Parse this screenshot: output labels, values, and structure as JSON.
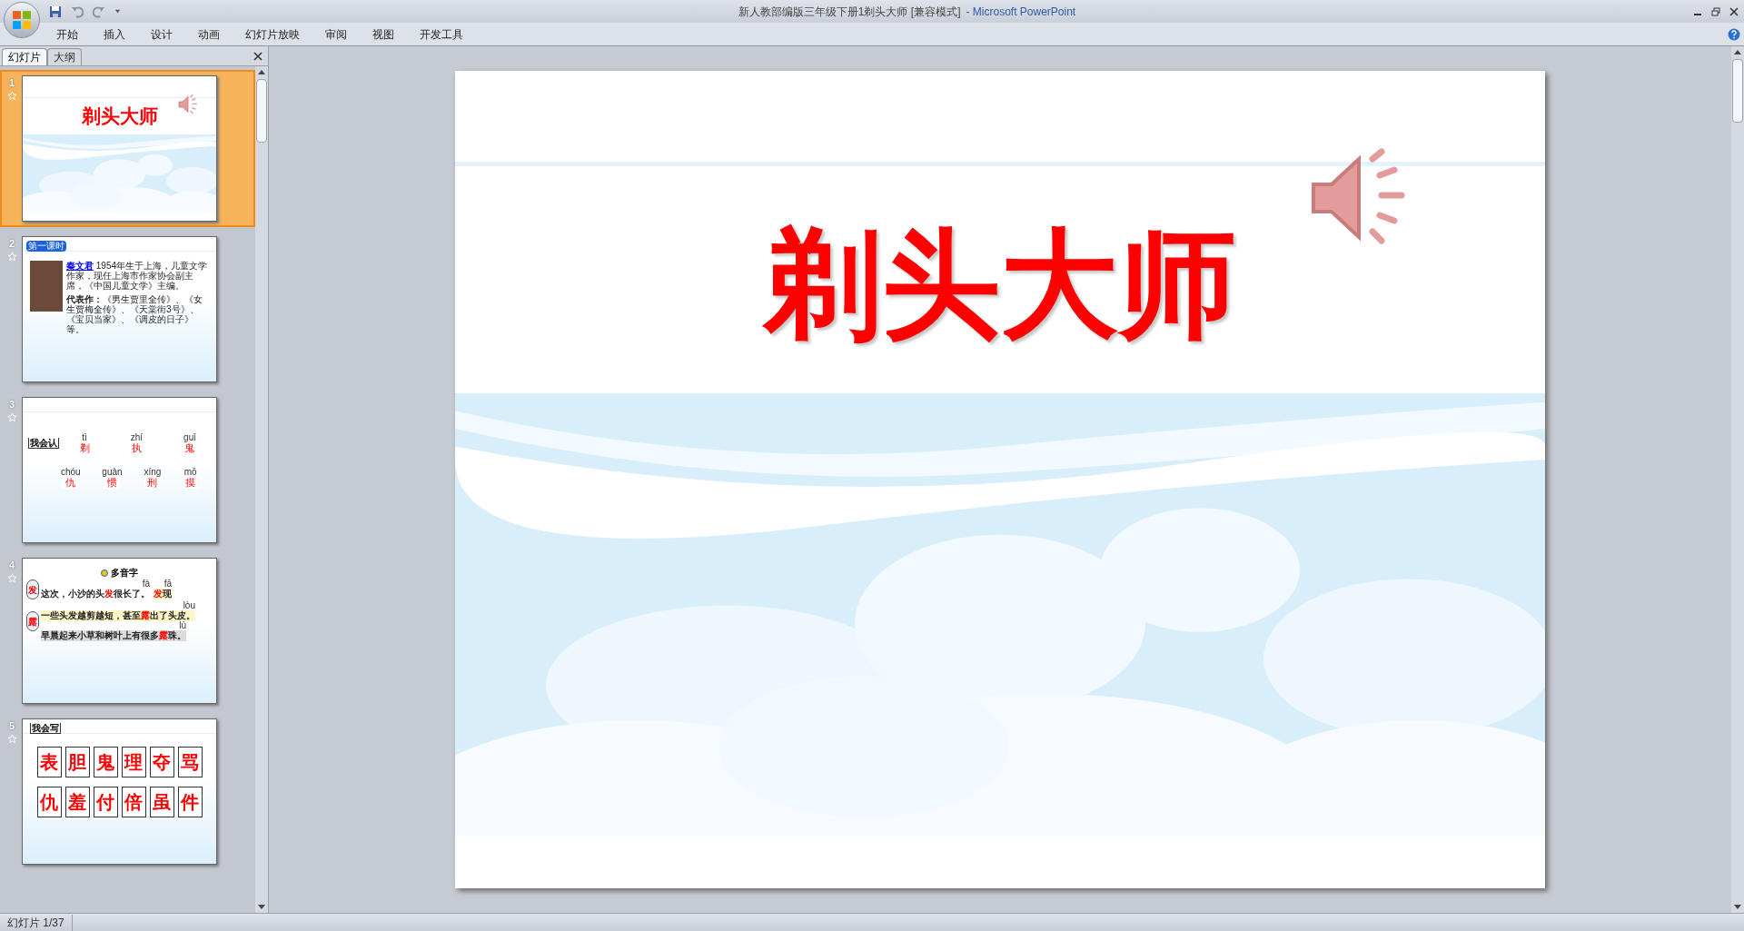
{
  "window": {
    "title": "新人教部编版三年级下册1剃头大师 [兼容模式]",
    "app_name": "- Microsoft PowerPoint"
  },
  "ribbon_tabs": [
    {
      "label": "开始"
    },
    {
      "label": "插入"
    },
    {
      "label": "设计"
    },
    {
      "label": "动画"
    },
    {
      "label": "幻灯片放映"
    },
    {
      "label": "审阅"
    },
    {
      "label": "视图"
    },
    {
      "label": "开发工具"
    }
  ],
  "panel_tabs": [
    {
      "label": "幻灯片",
      "selected": true
    },
    {
      "label": "大纲",
      "selected": false
    }
  ],
  "slides": [
    {
      "kind": "title",
      "number": "1",
      "selected": true,
      "title": "剃头大师"
    },
    {
      "kind": "author",
      "number": "2",
      "selected": false,
      "badge": "第一课时",
      "author": "秦文君",
      "bio": "1954年生于上海，儿童文学作家，现任上海市作家协会副主席，《中国儿童文学》主编。",
      "works": "**代表作：**《男生贾里全传》、《女生贾梅全传》、《天棠街3号》、《宝贝当家》、《调皮的日子》等。"
    },
    {
      "kind": "read",
      "number": "3",
      "selected": false,
      "label": "我会认",
      "rows": [
        {
          "words": [
            {
              "pinyin": "tì",
              "char": "剃"
            },
            {
              "pinyin": "zhí",
              "char": "执"
            },
            {
              "pinyin": "guǐ",
              "char": "鬼"
            }
          ]
        },
        {
          "words": [
            {
              "pinyin": "chóu",
              "char": "仇"
            },
            {
              "pinyin": "guàn",
              "char": "惯"
            },
            {
              "pinyin": "xíng",
              "char": "刑"
            },
            {
              "pinyin": "mō",
              "char": "摸"
            }
          ]
        }
      ]
    },
    {
      "kind": "polyphone",
      "number": "4",
      "selected": false,
      "heading": "多音字",
      "groups": [
        {
          "char": "发",
          "items": [
            {
              "pinyin": "fà",
              "before": "这次，小沙的头",
              "key": "发",
              "after": "很长了。"
            },
            {
              "pinyin": "fā",
              "key": "发",
              "after": "现",
              "color": "#fff6c8"
            }
          ]
        },
        {
          "char": "露",
          "items": [
            {
              "pinyin": "lòu",
              "before": "一些头发越剪越短，甚至",
              "key": "露",
              "after": "出了头皮。",
              "color": "#fff6c8"
            },
            {
              "pinyin": "lù",
              "before": "早晨起来小草和树叶上有很多",
              "key": "露",
              "after": "珠。",
              "color": "#dcdcdc"
            }
          ]
        }
      ]
    },
    {
      "kind": "write",
      "number": "5",
      "selected": false,
      "label": "我会写",
      "rows": [
        {
          "chars": [
            "表",
            "胆",
            "鬼",
            "理",
            "夺",
            "骂"
          ]
        },
        {
          "chars": [
            "仇",
            "羞",
            "付",
            "倍",
            "虽",
            "件"
          ]
        }
      ]
    }
  ],
  "main_slide": {
    "title": "剃头大师"
  },
  "status_bar": {
    "text": "幻灯片 1/37"
  }
}
